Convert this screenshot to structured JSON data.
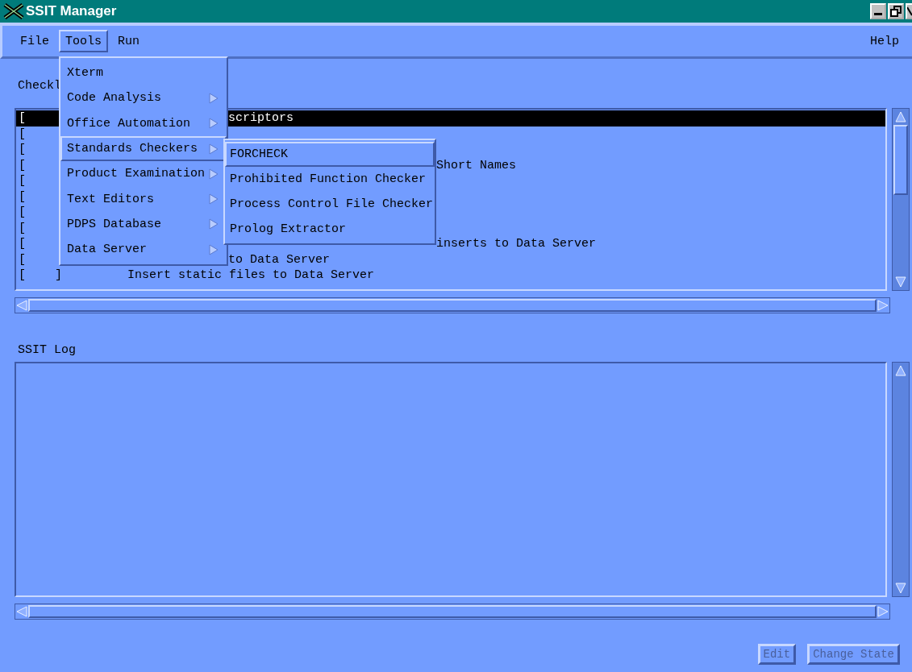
{
  "window": {
    "title": "SSIT Manager"
  },
  "menubar": [
    {
      "label": "File",
      "selected": false
    },
    {
      "label": "Tools",
      "selected": true
    },
    {
      "label": "Run",
      "selected": false
    },
    {
      "label": "Help",
      "selected": false,
      "kind": "right"
    }
  ],
  "tools_menu": [
    {
      "label": "Xterm",
      "submenu": false,
      "expanded": false
    },
    {
      "label": "Code Analysis",
      "submenu": true,
      "expanded": false
    },
    {
      "label": "Office Automation",
      "submenu": true,
      "expanded": false
    },
    {
      "label": "Standards Checkers",
      "submenu": true,
      "expanded": true
    },
    {
      "label": "Product Examination",
      "submenu": true,
      "expanded": false
    },
    {
      "label": "Text Editors",
      "submenu": true,
      "expanded": false
    },
    {
      "label": "PDPS Database",
      "submenu": true,
      "expanded": false
    },
    {
      "label": "Data Server",
      "submenu": true,
      "expanded": false
    }
  ],
  "standards_submenu": [
    {
      "label": "FORCHECK",
      "selected": true
    },
    {
      "label": "Prohibited Function Checker",
      "selected": false
    },
    {
      "label": "Process Control File Checker",
      "selected": false
    },
    {
      "label": "Prolog Extractor",
      "selected": false
    }
  ],
  "checklist": {
    "label": "Checkl",
    "rows": [
      {
        "open": "[",
        "text": "scriptors",
        "kind": "menu",
        "selected": true
      },
      {
        "open": "[",
        "selected": false
      },
      {
        "open": "[",
        "selected": false
      },
      {
        "open": "[",
        "text": "Short Names",
        "kind": "submenu",
        "selected": false
      },
      {
        "open": "[",
        "selected": false
      },
      {
        "open": "[",
        "selected": false
      },
      {
        "open": "[",
        "selected": false
      },
      {
        "open": "[",
        "selected": false
      },
      {
        "open": "[",
        "text": "inserts to Data Server",
        "kind": "submenu",
        "selected": false
      },
      {
        "open": "[",
        "text": "to Data Server",
        "kind": "menu",
        "selected": false
      },
      {
        "open": "[",
        "close": "]",
        "text": "Insert static files to Data Server",
        "kind": "full",
        "selected": false
      }
    ]
  },
  "log": {
    "label": "SSIT Log"
  },
  "buttons": [
    {
      "label": "Edit",
      "disabled": true
    },
    {
      "label": "Change State",
      "disabled": true
    }
  ]
}
